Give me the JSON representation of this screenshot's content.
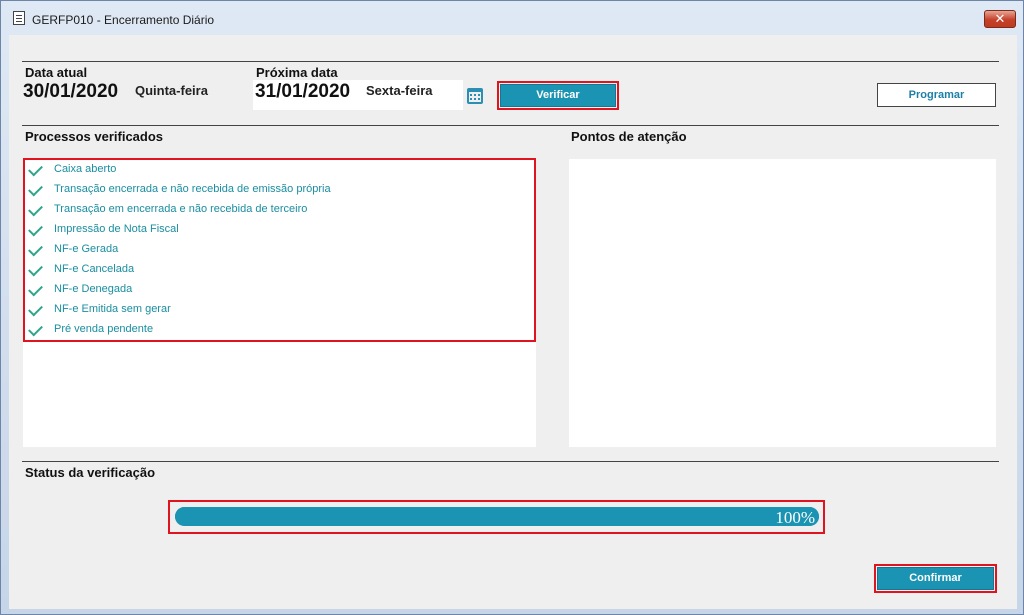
{
  "window": {
    "title": "GERFP010 - Encerramento Diário",
    "close_label": "✕"
  },
  "header": {
    "current_date_label": "Data atual",
    "current_date": "30/01/2020",
    "current_weekday": "Quinta-feira",
    "next_date_label": "Próxima data",
    "next_date": "31/01/2020",
    "next_weekday": "Sexta-feira",
    "verify_button": "Verificar",
    "schedule_button": "Programar"
  },
  "processes": {
    "title": "Processos verificados",
    "items": [
      {
        "label": "Caixa aberto",
        "checked": true
      },
      {
        "label": "Transação encerrada e não recebida de emissão própria",
        "checked": true
      },
      {
        "label": "Transação em encerrada e não recebida de terceiro",
        "checked": true
      },
      {
        "label": "Impressão de Nota Fiscal",
        "checked": true
      },
      {
        "label": "NF-e Gerada",
        "checked": true
      },
      {
        "label": "NF-e Cancelada",
        "checked": true
      },
      {
        "label": "NF-e Denegada",
        "checked": true
      },
      {
        "label": "NF-e Emitida sem gerar",
        "checked": true
      },
      {
        "label": "Pré venda pendente",
        "checked": true
      }
    ]
  },
  "attention": {
    "title": "Pontos de atenção"
  },
  "status": {
    "title": "Status da verificação",
    "progress": 1.0,
    "progress_text": "100%"
  },
  "footer": {
    "confirm_button": "Confirmar"
  },
  "colors": {
    "accent": "#1b93b3",
    "check": "#2ea58a",
    "highlight": "#e0141e"
  }
}
